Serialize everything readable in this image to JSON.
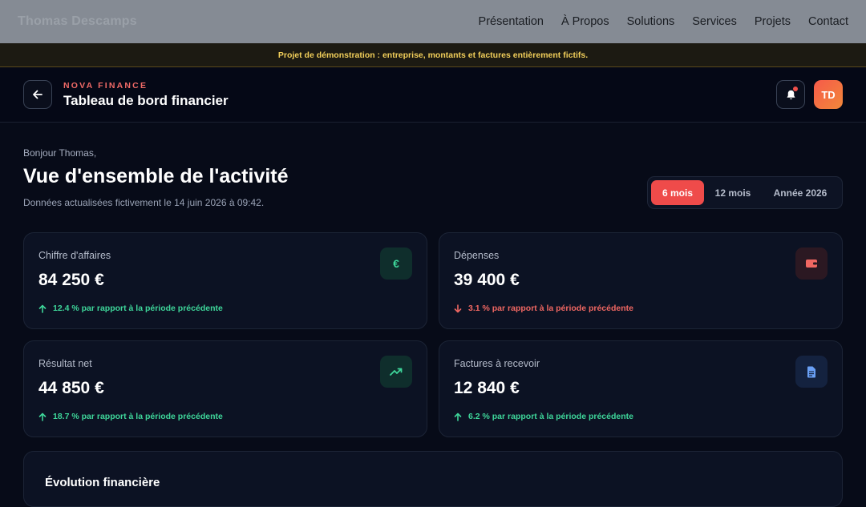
{
  "site": {
    "brand": "Thomas Descamps",
    "nav": [
      "Présentation",
      "À Propos",
      "Solutions",
      "Services",
      "Projets",
      "Contact"
    ]
  },
  "banner": "Projet de démonstration : entreprise, montants et factures entièrement fictifs.",
  "header": {
    "eyebrow": "NOVA FINANCE",
    "title": "Tableau de bord financier",
    "avatar_initials": "TD"
  },
  "intro": {
    "greeting": "Bonjour Thomas,",
    "title": "Vue d'ensemble de l'activité",
    "updated": "Données actualisées fictivement le 14 juin 2026 à 09:42."
  },
  "periods": {
    "options": [
      "6 mois",
      "12 mois",
      "Année 2026"
    ],
    "selected": "6 mois"
  },
  "kpis": [
    {
      "label": "Chiffre d'affaires",
      "value": "84 250 €",
      "trend": "12.4 % par rapport à la période précédente",
      "direction": "up",
      "icon": "euro-icon",
      "icon_color": "#3ed69a",
      "icon_bg": "#0f2e2c"
    },
    {
      "label": "Dépenses",
      "value": "39 400 €",
      "trend": "3.1 % par rapport à la période précédente",
      "direction": "down",
      "icon": "wallet-icon",
      "icon_color": "#f06762",
      "icon_bg": "#2b1822"
    },
    {
      "label": "Résultat net",
      "value": "44 850 €",
      "trend": "18.7 % par rapport à la période précédente",
      "direction": "up",
      "icon": "trending-up-icon",
      "icon_color": "#3ed69a",
      "icon_bg": "#0f2e2c"
    },
    {
      "label": "Factures à recevoir",
      "value": "12 840 €",
      "trend": "6.2 % par rapport à la période précédente",
      "direction": "up",
      "icon": "invoice-icon",
      "icon_color": "#6aa0f5",
      "icon_bg": "#14223f"
    }
  ],
  "chart_section": {
    "title": "Évolution financière"
  },
  "colors": {
    "accent": "#ef4b4a",
    "positive": "#3ed69a",
    "negative": "#f06762",
    "banner_text": "#f2cf5a"
  }
}
